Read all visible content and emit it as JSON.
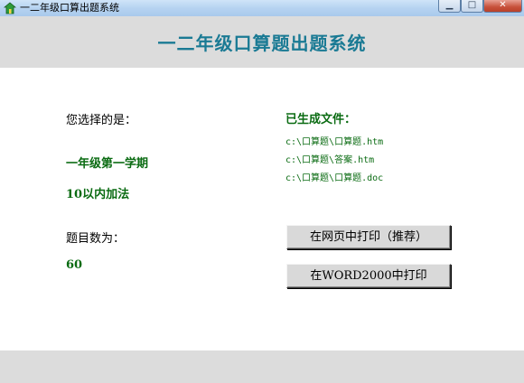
{
  "window": {
    "title": "一二年级口算出题系统",
    "min_glyph": "▁",
    "max_glyph": "□",
    "close_glyph": "✕"
  },
  "header": {
    "title": "一二年级口算题出题系统"
  },
  "selection": {
    "label": "您选择的是：",
    "grade": "一年级第一学期",
    "type": "10以内加法"
  },
  "count": {
    "label": "题目数为：",
    "value": "60"
  },
  "files": {
    "label": "已生成文件：",
    "paths": [
      "c:\\口算题\\口算题.htm",
      "c:\\口算题\\答案.htm",
      "c:\\口算题\\口算题.doc"
    ]
  },
  "buttons": {
    "print_web": "在网页中打印（推荐）",
    "print_word": "在WORD2000中打印"
  },
  "colors": {
    "accent": "#1a7a94",
    "value_green": "#0a6b12",
    "panel_gray": "#dcdcdc"
  }
}
